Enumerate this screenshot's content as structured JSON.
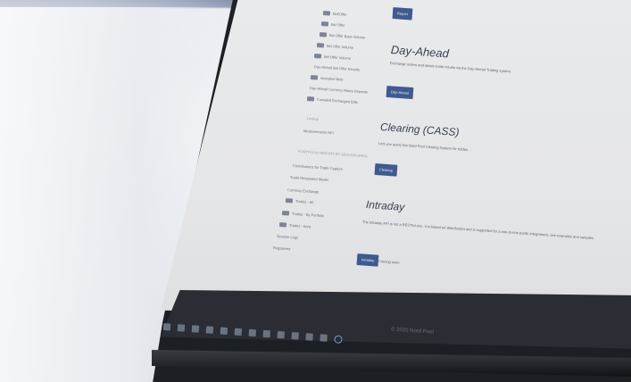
{
  "sidebar": {
    "items": [
      {
        "label": "Bid/Offer",
        "badge": true
      },
      {
        "label": "Bid Offer",
        "badge": true
      },
      {
        "label": "Bid Offer Base Volume",
        "badge": true
      },
      {
        "label": "Bid Offer Volume",
        "badge": true
      },
      {
        "label": "Bid Offer Volume",
        "badge": true
      },
      {
        "label": "Day-Ahead Bid Offer Results",
        "badge": false
      },
      {
        "label": "Accepted Bids",
        "badge": true
      },
      {
        "label": "Day-Ahead Currency Rates Reporter",
        "badge": false
      },
      {
        "label": "Curtailed Exchanged Bids",
        "badge": true
      }
    ],
    "group_label": "Lookup",
    "group_item": "Measurements API",
    "group2_label": "PORTFOLIO REPORT BY SESSION AREA",
    "items2": [
      {
        "label": "Contributions for Trade Capture",
        "badge": false
      },
      {
        "label": "Trade Requested Model",
        "badge": false
      },
      {
        "label": "Currency Exchange",
        "badge": false
      },
      {
        "label": "Trades - All",
        "badge": true
      },
      {
        "label": "Trades - By Portfolio",
        "badge": true
      },
      {
        "label": "Trades - Area",
        "badge": true
      },
      {
        "label": "Session Logs",
        "badge": false
      },
      {
        "label": "Registered",
        "badge": false
      }
    ]
  },
  "sections": [
    {
      "heading": "",
      "desc": "",
      "button": "Report"
    },
    {
      "heading": "Day-Ahead",
      "desc": "Exchange orders and obtain trade results via the Day-Ahead Trading system.",
      "button": "Day-Ahead"
    },
    {
      "heading": "Clearing (CASS)",
      "desc": "Lets you query the Nord Pool Clearing System for trades.",
      "button": "Clearing"
    },
    {
      "heading": "Intraday",
      "desc": "The Intraday API is not a RESTful one. It is based on WebSocket and is supported for a one-to-one public integrations, see examples and samples.",
      "desc2": "examples and samples.",
      "button": "Intraday",
      "button_note": "Coming soon."
    }
  ],
  "footer": {
    "text": "© 2020 Nord Pool"
  },
  "taskbar": {
    "icons": [
      "window-icon",
      "search-icon",
      "task-icon",
      "app-icon",
      "app-icon",
      "app-icon",
      "app-icon",
      "app-icon",
      "app-icon",
      "app-icon",
      "app-icon",
      "app-icon",
      "edge-icon"
    ]
  }
}
